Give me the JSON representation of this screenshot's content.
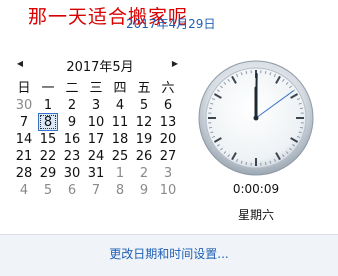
{
  "overlay_title": "那一天适合搬家呢",
  "header_date": "2017年4月29日",
  "calendar": {
    "month_label": "2017年5月",
    "weekdays": [
      "日",
      "一",
      "二",
      "三",
      "四",
      "五",
      "六"
    ],
    "weeks": [
      [
        "30",
        "1",
        "2",
        "3",
        "4",
        "5",
        "6"
      ],
      [
        "7",
        "8",
        "9",
        "10",
        "11",
        "12",
        "13"
      ],
      [
        "14",
        "15",
        "16",
        "17",
        "18",
        "19",
        "20"
      ],
      [
        "21",
        "22",
        "23",
        "24",
        "25",
        "26",
        "27"
      ],
      [
        "28",
        "29",
        "30",
        "31",
        "1",
        "2",
        "3"
      ],
      [
        "4",
        "5",
        "6",
        "7",
        "8",
        "9",
        "10"
      ]
    ],
    "prev_icon": "chevron-left-icon",
    "next_icon": "chevron-right-icon"
  },
  "clock": {
    "time_text": "0:00:09",
    "weekday_text": "星期六",
    "hours": 0,
    "minutes": 0,
    "seconds": 9
  },
  "footer": {
    "settings_link": "更改日期和时间设置..."
  },
  "colors": {
    "overlay_red": "#d80000",
    "link_blue": "#1f5fb3",
    "selection_blue": "#3a73c8"
  }
}
